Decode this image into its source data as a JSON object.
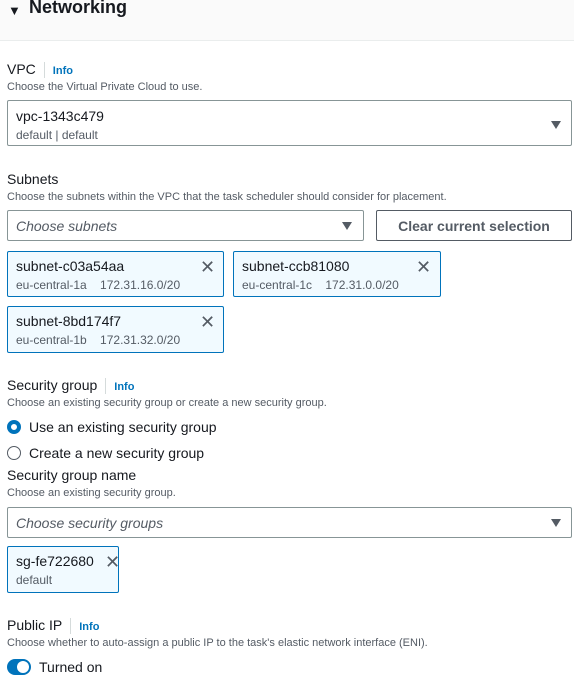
{
  "section": {
    "title": "Networking",
    "caret_icon": "caret-down-icon"
  },
  "vpc": {
    "label": "VPC",
    "info": "Info",
    "description": "Choose the Virtual Private Cloud to use.",
    "selected_value": "vpc-1343c479",
    "selected_detail": "default | default"
  },
  "subnets": {
    "label": "Subnets",
    "description": "Choose the subnets within the VPC that the task scheduler should consider for placement.",
    "placeholder": "Choose subnets",
    "clear_button": "Clear current selection",
    "tokens": [
      {
        "name": "subnet-c03a54aa",
        "az": "eu-central-1a",
        "cidr": "172.31.16.0/20",
        "detail": "eu-central-1a    172.31.16.0/20"
      },
      {
        "name": "subnet-ccb81080",
        "az": "eu-central-1c",
        "cidr": "172.31.0.0/20",
        "detail": "eu-central-1c    172.31.0.0/20"
      },
      {
        "name": "subnet-8bd174f7",
        "az": "eu-central-1b",
        "cidr": "172.31.32.0/20",
        "detail": "eu-central-1b    172.31.32.0/20"
      }
    ]
  },
  "security_group": {
    "label": "Security group",
    "info": "Info",
    "description": "Choose an existing security group or create a new security group.",
    "options": [
      {
        "label": "Use an existing security group",
        "selected": true
      },
      {
        "label": "Create a new security group",
        "selected": false
      }
    ],
    "name_label": "Security group name",
    "name_description": "Choose an existing security group.",
    "placeholder": "Choose security groups",
    "tokens": [
      {
        "name": "sg-fe722680",
        "detail": "default"
      }
    ]
  },
  "public_ip": {
    "label": "Public IP",
    "info": "Info",
    "description": "Choose whether to auto-assign a public IP to the task's elastic network interface (ENI).",
    "toggle_label": "Turned on",
    "enabled": true
  },
  "colors": {
    "accent": "#0073bb",
    "token_bg": "#f1faff",
    "text": "#16191f",
    "secondary_text": "#545b64"
  }
}
